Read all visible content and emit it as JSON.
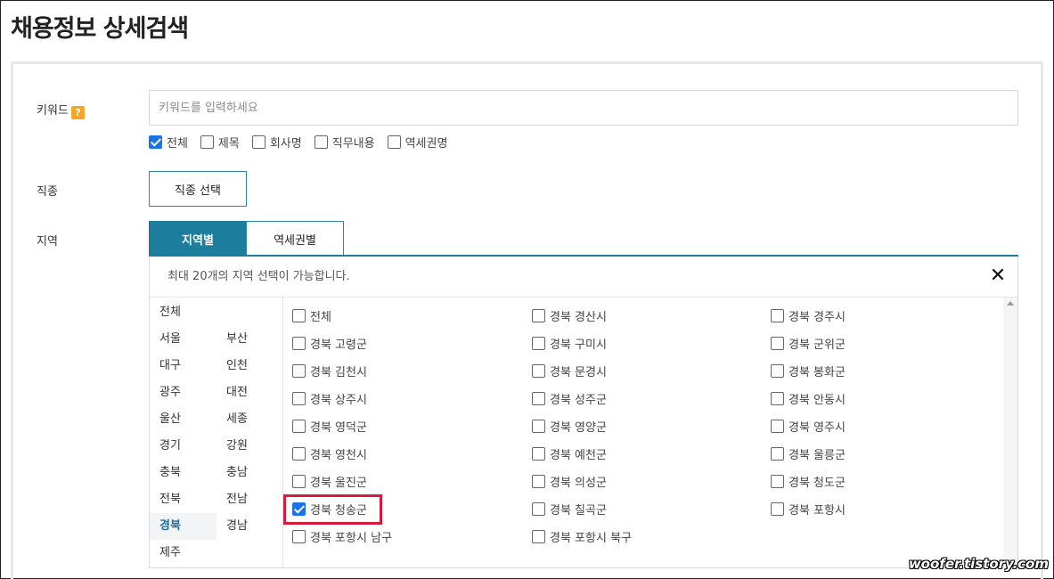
{
  "page": {
    "title": "채용정보 상세검색"
  },
  "keyword": {
    "label": "키워드",
    "help": "?",
    "placeholder": "키워드를 입력하세요",
    "options": [
      {
        "label": "전체",
        "checked": true
      },
      {
        "label": "제목",
        "checked": false
      },
      {
        "label": "회사명",
        "checked": false
      },
      {
        "label": "직무내용",
        "checked": false
      },
      {
        "label": "역세권명",
        "checked": false
      }
    ]
  },
  "jobtype": {
    "label": "직종",
    "button": "직종 선택"
  },
  "region": {
    "label": "지역",
    "tabs": [
      {
        "label": "지역별",
        "active": true
      },
      {
        "label": "역세권별",
        "active": false
      }
    ],
    "notice": "최대 20개의 지역 선택이 가능합니다.",
    "close": "✕",
    "sido": [
      "전체",
      "서울",
      "부산",
      "대구",
      "인천",
      "광주",
      "대전",
      "울산",
      "세종",
      "경기",
      "강원",
      "충북",
      "충남",
      "전북",
      "전남",
      "경북",
      "경남",
      "제주"
    ],
    "active_sido": "경북",
    "towns": [
      {
        "label": "전체",
        "checked": false
      },
      {
        "label": "경북 경산시",
        "checked": false
      },
      {
        "label": "경북 경주시",
        "checked": false
      },
      {
        "label": "경북 고령군",
        "checked": false
      },
      {
        "label": "경북 구미시",
        "checked": false
      },
      {
        "label": "경북 군위군",
        "checked": false
      },
      {
        "label": "경북 김천시",
        "checked": false
      },
      {
        "label": "경북 문경시",
        "checked": false
      },
      {
        "label": "경북 봉화군",
        "checked": false
      },
      {
        "label": "경북 상주시",
        "checked": false
      },
      {
        "label": "경북 성주군",
        "checked": false
      },
      {
        "label": "경북 안동시",
        "checked": false
      },
      {
        "label": "경북 영덕군",
        "checked": false
      },
      {
        "label": "경북 영양군",
        "checked": false
      },
      {
        "label": "경북 영주시",
        "checked": false
      },
      {
        "label": "경북 영천시",
        "checked": false
      },
      {
        "label": "경북 예천군",
        "checked": false
      },
      {
        "label": "경북 울릉군",
        "checked": false
      },
      {
        "label": "경북 울진군",
        "checked": false
      },
      {
        "label": "경북 의성군",
        "checked": false
      },
      {
        "label": "경북 청도군",
        "checked": false
      },
      {
        "label": "경북 청송군",
        "checked": true
      },
      {
        "label": "경북 칠곡군",
        "checked": false
      },
      {
        "label": "경북 포항시",
        "checked": false
      },
      {
        "label": "경북 포항시 남구",
        "checked": false
      },
      {
        "label": "경북 포항시 북구",
        "checked": false
      }
    ]
  },
  "watermark": "woofer.tistory.com",
  "colors": {
    "accent": "#1d7d9c",
    "check": "#1a73e8",
    "highlight": "#d81b3c",
    "help": "#f5a623"
  }
}
